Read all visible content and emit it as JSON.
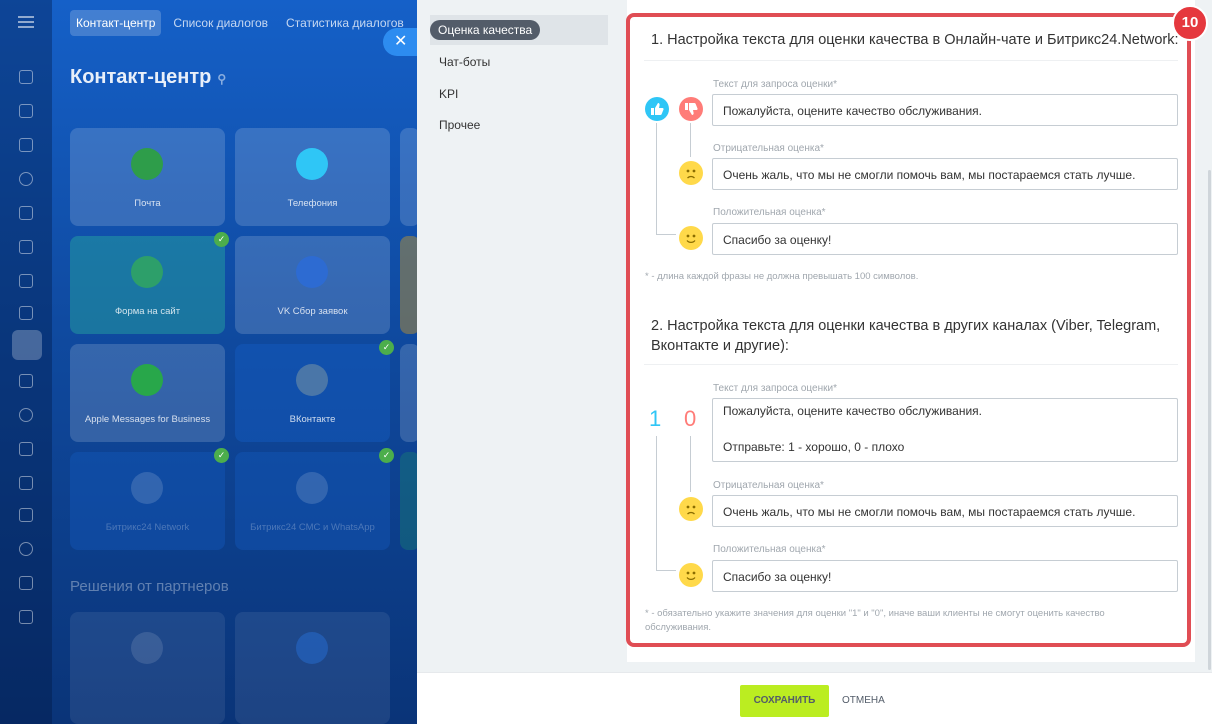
{
  "background": {
    "nav": [
      "Контакт-центр",
      "Список диалогов",
      "Статистика диалогов"
    ],
    "page_title": "Контакт-центр",
    "tiles": [
      {
        "label": "Почта",
        "color": "#2e9d4a"
      },
      {
        "label": "Телефония",
        "color": "#2fc6f6"
      },
      {
        "label": "Форма на сайт",
        "color": "#2d9f6a"
      },
      {
        "label": "VK Сбор заявок",
        "color": "#2d6bd2"
      },
      {
        "label": "Apple Messages for Business",
        "color": "#28a74a"
      },
      {
        "label": "ВКонтакте",
        "color": "#4a76a8"
      },
      {
        "label": "Битрикс24 Network",
        "color": "#9aa3ad"
      },
      {
        "label": "Битрикс24 СМС и WhatsApp",
        "color": "#9aa3ad"
      }
    ],
    "partners_heading": "Решения от партнеров"
  },
  "side_menu": {
    "items": [
      "Оценка качества",
      "Чат-боты",
      "KPI",
      "Прочее"
    ]
  },
  "annotation_badge": "10",
  "section1": {
    "title": "1. Настройка текста для оценки качества в Онлайн-чате и Битрикс24.Network:",
    "request_label": "Текст для запроса оценки*",
    "request_value": "Пожалуйста, оцените качество обслуживания.",
    "negative_label": "Отрицательная оценка*",
    "negative_value": "Очень жаль, что мы не смогли помочь вам, мы постараемся стать лучше.",
    "positive_label": "Положительная оценка*",
    "positive_value": "Спасибо за оценку!",
    "note": "* - длина каждой фразы не должна превышать 100 символов."
  },
  "section2": {
    "title": "2. Настройка текста для оценки качества в других каналах (Viber, Telegram, Вконтакте и другие):",
    "one": "1",
    "zero": "0",
    "request_label": "Текст для запроса оценки*",
    "request_value": "Пожалуйста, оцените качество обслуживания.\n\nОтправьте: 1 - хорошо, 0 - плохо",
    "negative_label": "Отрицательная оценка*",
    "negative_value": "Очень жаль, что мы не смогли помочь вам, мы постараемся стать лучше.",
    "positive_label": "Положительная оценка*",
    "positive_value": "Спасибо за оценку!",
    "note": "* - обязательно укажите значения для оценки \"1\" и \"0\", иначе ваши клиенты не смогут оценить качество обслуживания."
  },
  "footer": {
    "save": "СОХРАНИТЬ",
    "cancel": "ОТМЕНА"
  },
  "colors": {
    "like": "#2fc6f6",
    "dislike": "#ff7c78",
    "smile": "#ffd94a",
    "highlight": "#e04d54",
    "save_button": "#bbed21"
  }
}
